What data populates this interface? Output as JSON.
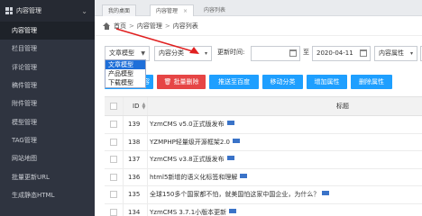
{
  "sidebar": {
    "header": "内容管理",
    "items": [
      {
        "label": "内容管理",
        "active": true
      },
      {
        "label": "栏目管理"
      },
      {
        "label": "评论管理"
      },
      {
        "label": "稿件管理"
      },
      {
        "label": "附件管理"
      },
      {
        "label": "模型管理"
      },
      {
        "label": "TAG管理"
      },
      {
        "label": "网站地图"
      },
      {
        "label": "批量更新URL"
      },
      {
        "label": "生成静态HTML"
      }
    ]
  },
  "tabs": [
    {
      "label": "我的桌面"
    },
    {
      "label": "内容管理"
    }
  ],
  "tab_next_label": "内容列表",
  "breadcrumb": {
    "home": "首页",
    "level1": "内容管理",
    "level2": "内容列表"
  },
  "filters": {
    "model_value": "文章模型",
    "category_value": "内容分类",
    "time_label": "更新时间:",
    "range_sep": "至",
    "end_date": "2020-04-11",
    "attr_value": "内容属性"
  },
  "model_options": [
    "文章模型",
    "产品模型",
    "下载模型"
  ],
  "toolbar": {
    "first_suffix": "容",
    "batch_delete": "批量删除",
    "push_baidu": "推送至百度",
    "move_category": "移动分类",
    "add_attr": "增加属性",
    "del_attr": "删除属性"
  },
  "table": {
    "col_id": "ID",
    "col_title": "标题",
    "rows": [
      {
        "id": "139",
        "title": "YzmCMS v5.0正式版发布"
      },
      {
        "id": "138",
        "title": "YZMPHP轻量级开源框架2.0"
      },
      {
        "id": "137",
        "title": "YzmCMS v3.8正式版发布"
      },
      {
        "id": "136",
        "title": "html5新增的语义化标签和理解"
      },
      {
        "id": "135",
        "title": "全球150多个国家都不怕，就美国怕这家中国企业，为什么？"
      },
      {
        "id": "134",
        "title": "YzmCMS 3.7.1小版本更新"
      }
    ]
  },
  "colors": {
    "sidebar_bg": "#2f3440",
    "primary": "#1e9fff",
    "danger": "#e64545",
    "dropdown_highlight": "#1e6fd9",
    "annotation": "#e02020"
  }
}
